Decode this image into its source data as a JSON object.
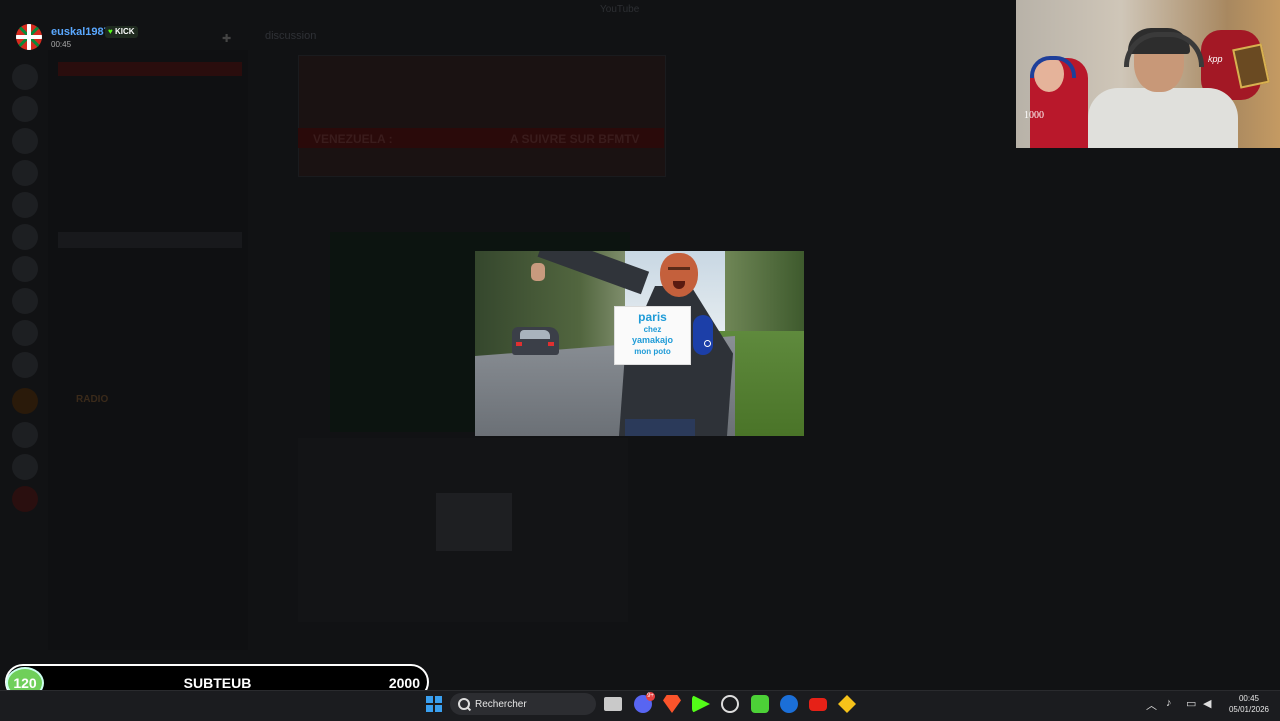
{
  "window": {
    "title": "YouTube"
  },
  "channel": {
    "header": "discussion"
  },
  "streamer": {
    "name": "euskal1987",
    "platform_badge": "KICK",
    "timer": "00:45"
  },
  "news": {
    "text1": "VENEZUELA :",
    "text2": "A SUIVRE SUR BFMTV"
  },
  "popup_sign": {
    "line1": "paris",
    "line2": "chez",
    "line3": "yamakajo",
    "line4": "mon poto"
  },
  "webcam": {
    "shirt_text": "kpp",
    "tag": "1000"
  },
  "sub_bar": {
    "current": "120",
    "label": "SUBTEUB",
    "goal": "2000"
  },
  "sidebar": {
    "radio": "RADIO"
  },
  "taskbar": {
    "search_placeholder": "Rechercher",
    "discord_badge": "9+",
    "time": "00:45",
    "date": "05/01/2026"
  },
  "icons": [
    "windows-start-icon",
    "search-icon",
    "file-explorer-icon",
    "discord-icon",
    "brave-icon",
    "kick-icon",
    "obs-icon",
    "spotify-icon",
    "steam-icon",
    "youtube-icon",
    "bluestacks-icon",
    "chevron-up-icon",
    "microphone-icon",
    "network-icon",
    "volume-icon"
  ],
  "colors": {
    "kick_green": "#53fc18",
    "username_blue": "#5aa8ff",
    "sign_blue": "#1e9bd7",
    "sub_green": "#6fcf5a"
  }
}
